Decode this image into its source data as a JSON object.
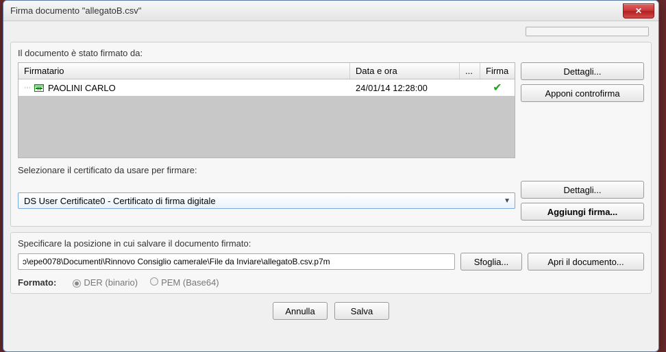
{
  "window": {
    "title": "Firma documento \"allegatoB.csv\""
  },
  "section1": {
    "heading": "Il documento è stato firmato da:",
    "columns": {
      "signer": "Firmatario",
      "datetime": "Data e ora",
      "dots": "...",
      "sig": "Firma"
    },
    "rows": [
      {
        "name": "PAOLINI CARLO",
        "datetime": "24/01/14 12:28:00",
        "signed": "✔"
      }
    ],
    "btn_details": "Dettagli...",
    "btn_countersign": "Apponi controfirma",
    "cert_heading": "Selezionare il certificato da usare per firmare:",
    "cert_value": "DS User Certificate0 - Certificato di firma digitale",
    "btn_cert_details": "Dettagli...",
    "btn_add_sig": "Aggiungi firma..."
  },
  "section2": {
    "heading": "Specificare la posizione in cui salvare il documento firmato:",
    "path": "ɔ\\epe0078\\Documenti\\Rinnovo Consiglio camerale\\File da Inviare\\allegatoB.csv.p7m",
    "btn_browse": "Sfoglia...",
    "btn_open": "Apri il documento...",
    "format_label": "Formato:",
    "opt_der": "DER (binario)",
    "opt_pem": "PEM (Base64)"
  },
  "footer": {
    "cancel": "Annulla",
    "save": "Salva"
  }
}
